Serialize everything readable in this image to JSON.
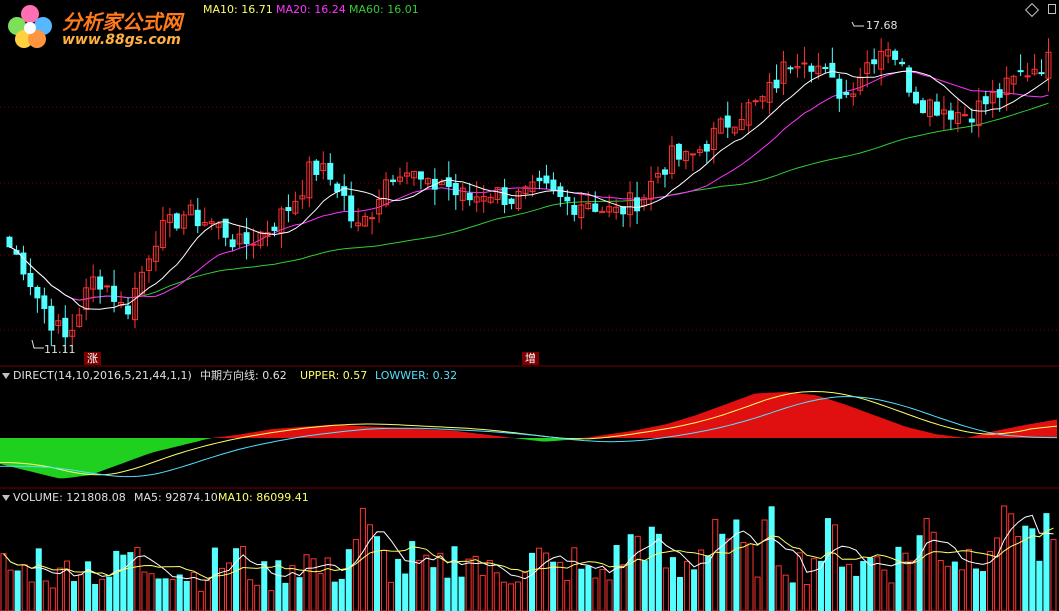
{
  "watermark": {
    "name": "分析家公式网",
    "url": "www.88gs.com"
  },
  "colors": {
    "up": "#ff3232",
    "down": "#54ffff",
    "ma10": "#ffffff",
    "ma20": "#ff33ff",
    "ma60": "#33cc33",
    "yellow": "#ffff66",
    "grid": "#7a0000"
  },
  "price_panel": {
    "ma10_label": "MA10: 16.71",
    "ma20_label": "MA20: 16.24",
    "ma60_label": "MA60: 16.01",
    "high_label": "17.68",
    "low_label": "11.11",
    "marker_left": "涨",
    "marker_mid": "增"
  },
  "direct_panel": {
    "label": "DIRECT(14,10,2016,5,21,44,1,1)",
    "line_label": "中期方向线: 0.62",
    "upper_label": "UPPER: 0.57",
    "lower_label": "LOWWER: 0.32"
  },
  "volume_panel": {
    "volume_label": "VOLUME: 121808.08",
    "ma5_label": "MA5: 92874.10",
    "ma10_label": "MA10: 86099.41"
  },
  "chart_data": {
    "type": "candlestick",
    "high": 17.68,
    "low": 11.11,
    "ma10": 16.71,
    "ma20": 16.24,
    "ma60": 16.01,
    "direct": 0.62,
    "upper": 0.57,
    "lower": 0.32,
    "volume": 121808.08,
    "volume_ma5": 92874.1,
    "volume_ma10": 86099.41,
    "price_curve": [
      13.2,
      12.8,
      12.1,
      11.6,
      11.2,
      12.0,
      12.6,
      12.3,
      11.8,
      12.5,
      13.4,
      13.6,
      13.9,
      13.8,
      13.7,
      13.5,
      13.2,
      13.4,
      13.6,
      13.9,
      14.3,
      14.9,
      14.7,
      14.4,
      13.5,
      13.9,
      14.6,
      14.9,
      14.7,
      14.4,
      14.6,
      14.3,
      14.2,
      14.4,
      14.3,
      14.2,
      14.3,
      14.4,
      14.2,
      14.1,
      14.2,
      14.0,
      13.9,
      14.1,
      14.3,
      14.8,
      15.1,
      15.0,
      15.3,
      15.6,
      15.9,
      16.1,
      16.2,
      16.6,
      17.1,
      17.3,
      17.0,
      16.6,
      16.4,
      16.9,
      17.3,
      17.5,
      16.8,
      16.3,
      16.2,
      16.1,
      16.0,
      16.1,
      16.3,
      16.5,
      16.8,
      17.0,
      17.1
    ],
    "direct_curve": [
      -0.35,
      -0.45,
      -0.55,
      -0.5,
      -0.35,
      -0.2,
      -0.1,
      0.0,
      0.05,
      0.12,
      0.15,
      0.18,
      0.16,
      0.14,
      0.12,
      0.1,
      0.05,
      0.0,
      -0.05,
      -0.02,
      0.04,
      0.1,
      0.18,
      0.3,
      0.45,
      0.6,
      0.62,
      0.58,
      0.45,
      0.3,
      0.15,
      0.05,
      0.0,
      0.1,
      0.18,
      0.25
    ],
    "volume_bars": [
      34,
      28,
      39,
      22,
      41,
      31,
      27,
      45,
      33,
      38,
      29,
      26,
      35,
      42,
      30,
      24,
      36,
      40,
      28,
      33,
      65,
      44,
      31,
      38,
      27,
      35,
      48,
      30,
      26,
      33,
      41,
      29,
      37,
      25,
      32,
      45,
      60,
      38,
      27,
      43,
      70,
      52,
      36,
      58,
      40,
      33,
      47,
      55,
      30,
      42,
      35,
      48,
      62,
      44,
      39,
      51,
      73,
      80,
      45,
      55
    ]
  }
}
